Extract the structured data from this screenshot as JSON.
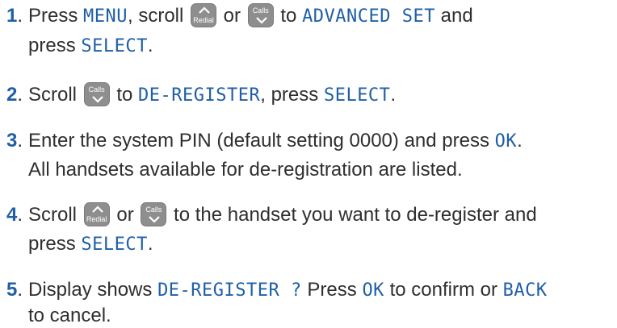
{
  "keys": {
    "redial": "Redial",
    "calls": "Calls"
  },
  "steps": [
    {
      "number": "1",
      "line1": {
        "a": "Press ",
        "menu": "MENU",
        "b": ", scroll ",
        "or": " or ",
        "to": " to ",
        "adv": "ADVANCED SET",
        "and": " and"
      },
      "line2": {
        "a": "press ",
        "select": "SELECT",
        "end": "."
      }
    },
    {
      "number": "2",
      "line1": {
        "a": "Scroll ",
        "to": " to ",
        "dereg": "DE-REGISTER",
        "mid": ", press ",
        "select": "SELECT",
        "end": "."
      }
    },
    {
      "number": "3",
      "line1": {
        "a": "Enter the system PIN (default setting 0000) and press ",
        "ok": "OK",
        "end": "."
      },
      "line2": "All handsets available for de-registration are listed."
    },
    {
      "number": "4",
      "line1": {
        "a": "Scroll ",
        "or": " or ",
        "rest": " to the handset you want to de-register and"
      },
      "line2": {
        "a": "press ",
        "select": "SELECT",
        "end": "."
      }
    },
    {
      "number": "5",
      "line1": {
        "a": "Display shows ",
        "dereg": "DE-REGISTER ?",
        "b": " Press ",
        "ok": "OK",
        "c": " to confirm or ",
        "back": "BACK"
      },
      "line2": "to cancel."
    }
  ]
}
